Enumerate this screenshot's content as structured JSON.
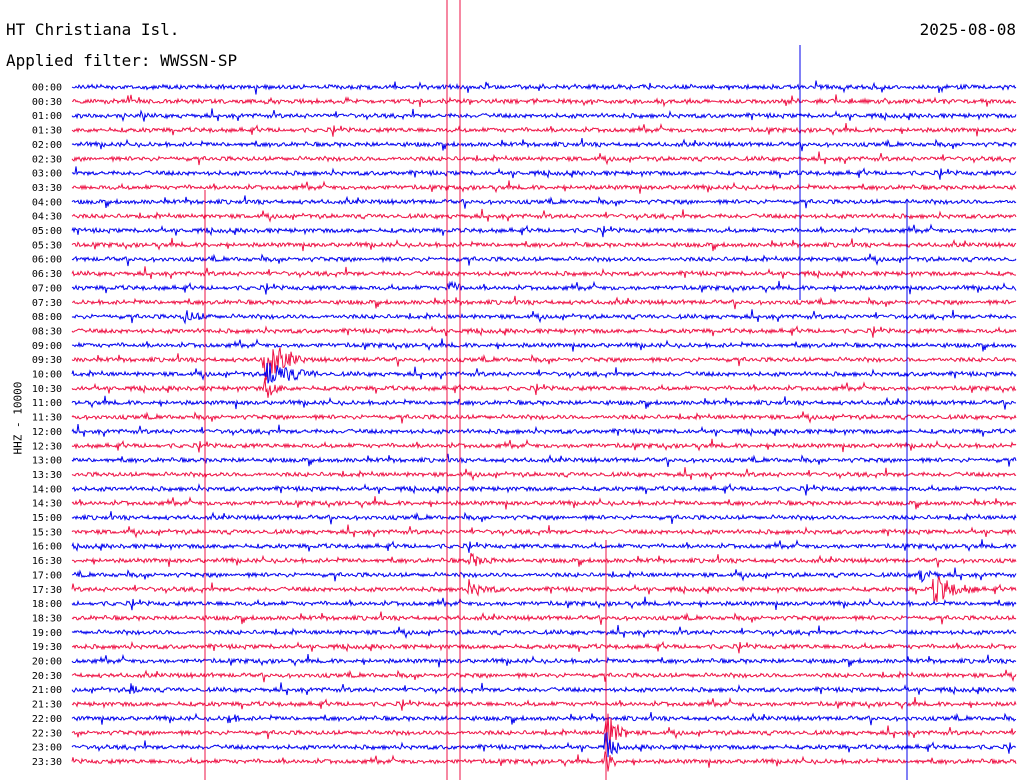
{
  "header": {
    "station": "HT Christiana Isl.",
    "date": "2025-08-08",
    "filter": "Applied filter: WWSSN-SP"
  },
  "channel_label": "HHZ - 10000",
  "colors": {
    "trace_a": "#0000ee",
    "trace_b": "#ee1144",
    "text": "#000000"
  },
  "rows": [
    "00:00",
    "00:30",
    "01:00",
    "01:30",
    "02:00",
    "02:30",
    "03:00",
    "03:30",
    "04:00",
    "04:30",
    "05:00",
    "05:30",
    "06:00",
    "06:30",
    "07:00",
    "07:30",
    "08:00",
    "08:30",
    "09:00",
    "09:30",
    "10:00",
    "10:30",
    "11:00",
    "11:30",
    "12:00",
    "12:30",
    "13:00",
    "13:30",
    "14:00",
    "14:30",
    "15:00",
    "15:30",
    "16:00",
    "16:30",
    "17:00",
    "17:30",
    "18:00",
    "18:30",
    "19:00",
    "19:30",
    "20:00",
    "20:30",
    "21:00",
    "21:30",
    "22:00",
    "22:30",
    "23:00",
    "23:30"
  ]
}
